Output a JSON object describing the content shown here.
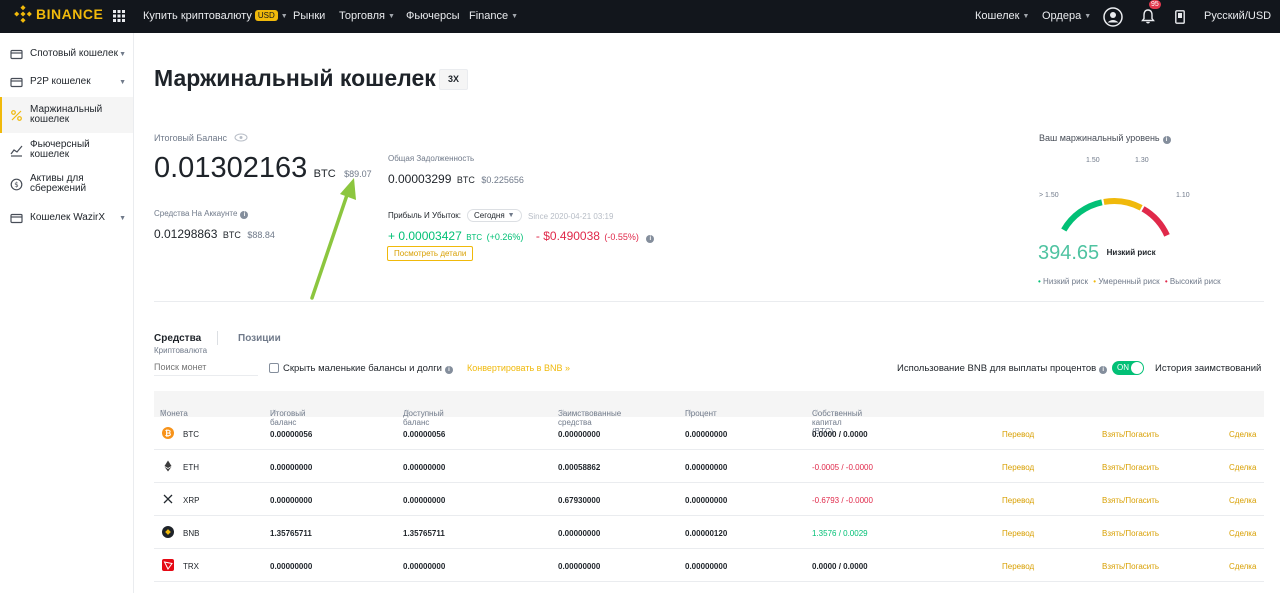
{
  "topbar": {
    "logo_text": "BINANCE",
    "nav": {
      "buy_crypto": "Купить криптовалюту",
      "buy_badge": "USD",
      "markets": "Рынки",
      "trade": "Торговля",
      "futures": "Фьючерсы",
      "finance": "Finance"
    },
    "wallet": "Кошелек",
    "orders": "Ордера",
    "notif_count": "95",
    "lang": "Русский/USD"
  },
  "sidebar": {
    "items": [
      {
        "label": "Спотовый кошелек"
      },
      {
        "label": "P2P кошелек"
      },
      {
        "label_1": "Маржинальный",
        "label_2": "кошелек"
      },
      {
        "label_1": "Фьючерсный",
        "label_2": "кошелек"
      },
      {
        "label_1": "Активы для",
        "label_2": "сбережений"
      },
      {
        "label": "Кошелек WazirX"
      }
    ]
  },
  "main": {
    "title": "Маржинальный кошелек",
    "leverage": "3X",
    "total_balance_label": "Итоговый Баланс",
    "total_balance_value": "0.01302163",
    "total_balance_unit": "BTC",
    "total_balance_usd": "$89.07",
    "debt_label": "Общая Задолженность",
    "debt_value": "0.00003299",
    "debt_unit": "BTC",
    "debt_usd": "$0.225656",
    "account_funds_label": "Средства На Аккаунте",
    "account_funds_value": "0.01298863",
    "account_funds_unit": "BTC",
    "account_funds_usd": "$88.84",
    "pnl_label": "Прибыль И Убыток:",
    "pnl_period": "Сегодня",
    "pnl_since": "Since 2020-04-21 03:19",
    "pnl_btc": "+ 0.00003427",
    "pnl_btc_unit": "BTC",
    "pnl_btc_pct": "(+0.26%)",
    "pnl_usd": "- $0.490038",
    "pnl_usd_pct": "(-0.55%)",
    "details_btn": "Посмотреть детали",
    "margin_level_label": "Ваш маржинальный уровень",
    "gauge_labels": {
      "l1": "> 1.50",
      "l2": "1.50",
      "l3": "1.30",
      "l4": "1.10"
    },
    "margin_level_value": "394.65",
    "margin_level_level": 0.07,
    "risk_label": "Низкий риск",
    "legend": {
      "low": "Низкий риск",
      "mid": "Умеренный риск",
      "high": "Высокий риск"
    },
    "colors": {
      "low": "#02c076",
      "mid": "#f0b90b",
      "high": "#e0294a"
    }
  },
  "tabs": {
    "assets": "Средства",
    "assets_sub": "Криптовалюта",
    "positions": "Позиции"
  },
  "filters": {
    "search_placeholder": "Поиск монет",
    "hide_small": "Скрыть маленькие балансы и долги",
    "convert_bnb": "Конвертировать в BNB »",
    "bnb_interest": "Использование BNB для выплаты процентов",
    "toggle_label": "ON",
    "borrow_history": "История заимствований"
  },
  "table": {
    "headers": {
      "coin": "Монета",
      "total": "Итоговый баланс",
      "available": "Доступный баланс",
      "borrowed": "Заимствованные средства",
      "interest": "Процент",
      "equity": "Собственный капитал (BTC)"
    },
    "actions": {
      "transfer": "Перевод",
      "borrow": "Взять/Погасить",
      "trade": "Сделка"
    },
    "rows": [
      {
        "coin": "BTC",
        "total": "0.00000056",
        "available": "0.00000056",
        "borrowed": "0.00000000",
        "interest": "0.00000000",
        "equity": "0.0000 / 0.0000"
      },
      {
        "coin": "ETH",
        "total": "0.00000000",
        "available": "0.00000000",
        "borrowed": "0.00058862",
        "interest": "0.00000000",
        "equity": "-0.0005 / -0.0000"
      },
      {
        "coin": "XRP",
        "total": "0.00000000",
        "available": "0.00000000",
        "borrowed": "0.67930000",
        "interest": "0.00000000",
        "equity": "-0.6793 / -0.0000"
      },
      {
        "coin": "BNB",
        "total": "1.35765711",
        "available": "1.35765711",
        "borrowed": "0.00000000",
        "interest": "0.00000120",
        "equity": "1.3576 / 0.0029"
      },
      {
        "coin": "TRX",
        "total": "0.00000000",
        "available": "0.00000000",
        "borrowed": "0.00000000",
        "interest": "0.00000000",
        "equity": "0.0000 / 0.0000"
      }
    ]
  }
}
